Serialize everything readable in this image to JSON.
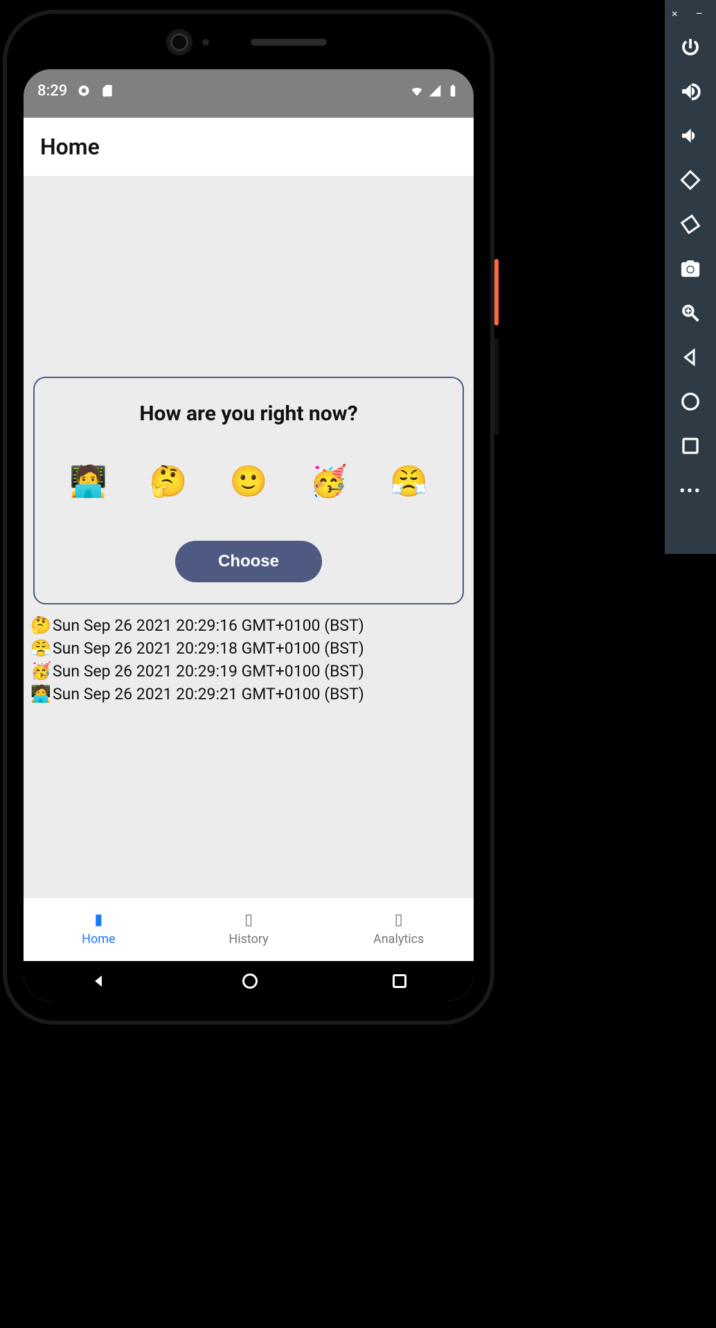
{
  "statusbar": {
    "time": "8:29"
  },
  "appbar": {
    "title": "Home"
  },
  "card": {
    "title": "How are you right now?",
    "emojis": [
      "🧑‍💻",
      "🤔",
      "🙂",
      "🥳",
      "😤"
    ],
    "choose_label": "Choose"
  },
  "log": [
    {
      "emoji": "🤔",
      "text": "Sun Sep 26 2021 20:29:16 GMT+0100 (BST)"
    },
    {
      "emoji": "😤",
      "text": "Sun Sep 26 2021 20:29:18 GMT+0100 (BST)"
    },
    {
      "emoji": "🥳",
      "text": "Sun Sep 26 2021 20:29:19 GMT+0100 (BST)"
    },
    {
      "emoji": "🧑‍💻",
      "text": "Sun Sep 26 2021 20:29:21 GMT+0100 (BST)"
    }
  ],
  "tabs": {
    "items": [
      {
        "label": "Home",
        "active": true
      },
      {
        "label": "History",
        "active": false
      },
      {
        "label": "Analytics",
        "active": false
      }
    ]
  },
  "emulator": {
    "close": "×",
    "minimize": "–"
  }
}
